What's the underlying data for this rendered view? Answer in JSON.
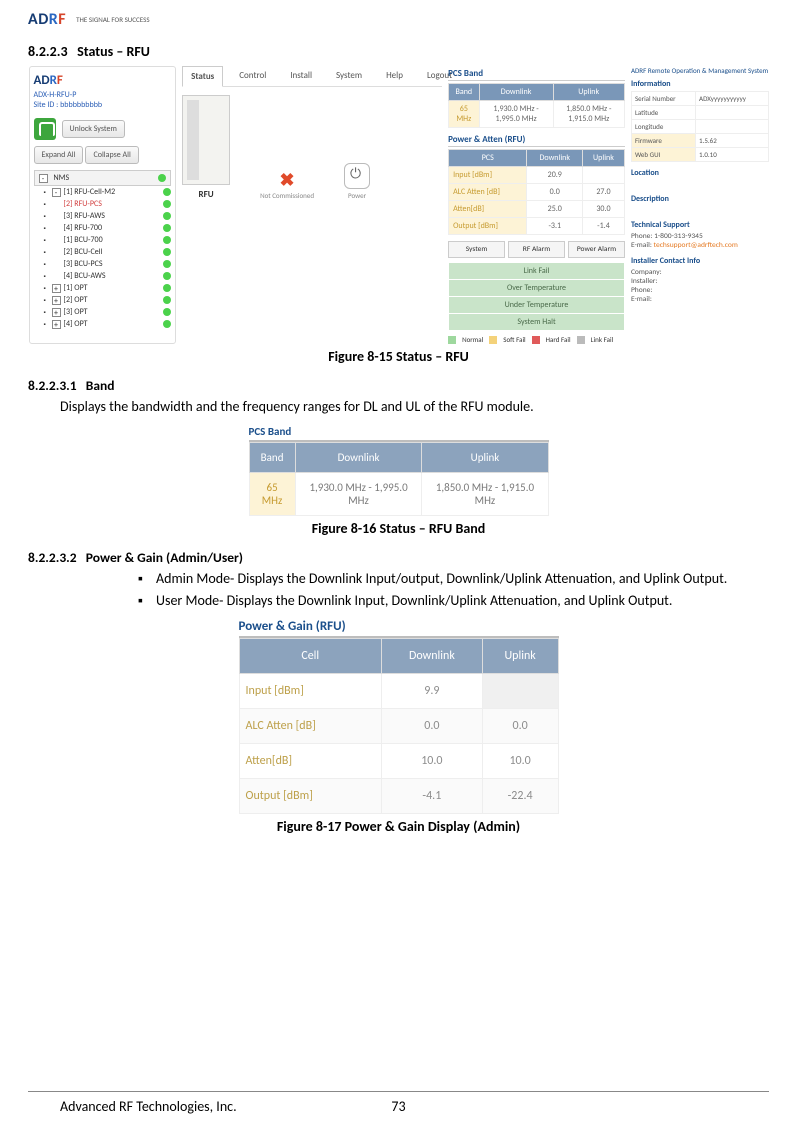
{
  "header_logo": {
    "brand": "ADRF",
    "tagline": "THE SIGNAL FOR SUCCESS"
  },
  "sec_8_2_2_3": {
    "num": "8.2.2.3",
    "title": "Status – RFU"
  },
  "fig15_caption": "Figure 8-15    Status – RFU",
  "sec_8_2_2_3_1": {
    "num": "8.2.2.3.1",
    "title": "Band"
  },
  "band_text": "Displays the bandwidth and the frequency ranges for DL and UL of the RFU module.",
  "fig16_caption": "Figure 8-16    Status – RFU Band",
  "sec_8_2_2_3_2": {
    "num": "8.2.2.3.2",
    "title": "Power & Gain (Admin/User)"
  },
  "bullets": [
    "Admin Mode- Displays the Downlink Input/output, Downlink/Uplink Attenuation, and Uplink Output.",
    "User Mode- Displays the Downlink Input, Downlink/Uplink Attenuation, and Uplink Output."
  ],
  "fig17_caption": "Figure 8-17    Power & Gain Display (Admin)",
  "footer": {
    "company": "Advanced RF Technologies, Inc.",
    "page": "73"
  },
  "shot15": {
    "device_name": "ADX-H-RFU-P",
    "site_id": "Site ID : bbbbbbbbbb",
    "unlock": "Unlock System",
    "expand": "Expand All",
    "collapse": "Collapse All",
    "tree_head": "NMS",
    "tree": [
      {
        "sym": "-",
        "label": "[1] RFU-Cell-M2",
        "red": false
      },
      {
        "sym": "",
        "label": "[2] RFU-PCS",
        "red": true
      },
      {
        "sym": "",
        "label": "[3] RFU-AWS",
        "red": false
      },
      {
        "sym": "",
        "label": "[4] RFU-700",
        "red": false
      },
      {
        "sym": "",
        "label": "[1] BCU-700",
        "red": false
      },
      {
        "sym": "",
        "label": "[2] BCU-Cell",
        "red": false
      },
      {
        "sym": "",
        "label": "[3] BCU-PCS",
        "red": false
      },
      {
        "sym": "",
        "label": "[4] BCU-AWS",
        "red": false
      },
      {
        "sym": "+",
        "label": "[1] OPT",
        "red": false
      },
      {
        "sym": "+",
        "label": "[2] OPT",
        "red": false
      },
      {
        "sym": "+",
        "label": "[3] OPT",
        "red": false
      },
      {
        "sym": "+",
        "label": "[4] OPT",
        "red": false
      }
    ],
    "tabs": [
      "Status",
      "Control",
      "Install",
      "System",
      "Help",
      "Logout"
    ],
    "rfu_label": "RFU",
    "nc_label": "Not Commissioned",
    "power_label": "Power",
    "pcs_band_title": "PCS Band",
    "pcs_band": {
      "headers": [
        "Band",
        "Downlink",
        "Uplink"
      ],
      "row": [
        "65 MHz",
        "1,930.0 MHz - 1,995.0 MHz",
        "1,850.0 MHz - 1,915.0 MHz"
      ]
    },
    "pa_title": "Power & Atten (RFU)",
    "pa": {
      "headers": [
        "PCS",
        "Downlink",
        "Uplink"
      ],
      "rows": [
        [
          "Input [dBm]",
          "20.9",
          ""
        ],
        [
          "ALC Atten [dB]",
          "0.0",
          "27.0"
        ],
        [
          "Atten[dB]",
          "25.0",
          "30.0"
        ],
        [
          "Output [dBm]",
          "-3.1",
          "-1.4"
        ]
      ]
    },
    "status_btns": [
      "System",
      "RF Alarm",
      "Power Alarm"
    ],
    "alarm_rows": [
      "Link Fail",
      "Over Temperature",
      "Under Temperature",
      "System Halt"
    ],
    "legend": [
      "Normal",
      "Soft Fail",
      "Hard Fail",
      "Link Fail"
    ],
    "info": {
      "title1": "ADRF Remote Operation & Management System",
      "title2": "Information",
      "rows": [
        [
          "Serial Number",
          "ADXyyyyyyyyyyy"
        ],
        [
          "Latitude",
          ""
        ],
        [
          "Longitude",
          ""
        ],
        [
          "Firmware",
          "1.5.62"
        ],
        [
          "Web GUI",
          "1.0.10"
        ]
      ],
      "loc": "Location",
      "desc": "Description",
      "tech": "Technical Support",
      "phone": "Phone: 1-800-313-9345",
      "email_lbl": "E-mail: ",
      "email": "techsupport@adrftech.com",
      "inst": "Installer Contact Info",
      "inst_rows": [
        "Company:",
        "Installer:",
        "Phone:",
        "E-mail:"
      ]
    }
  },
  "tbl816": {
    "title": "PCS Band",
    "headers": [
      "Band",
      "Downlink",
      "Uplink"
    ],
    "row": [
      "65 MHz",
      "1,930.0 MHz - 1,995.0 MHz",
      "1,850.0 MHz - 1,915.0 MHz"
    ]
  },
  "tbl817": {
    "title": "Power & Gain (RFU)",
    "headers": [
      "Cell",
      "Downlink",
      "Uplink"
    ],
    "rows": [
      [
        "Input [dBm]",
        "9.9",
        ""
      ],
      [
        "ALC Atten [dB]",
        "0.0",
        "0.0"
      ],
      [
        "Atten[dB]",
        "10.0",
        "10.0"
      ],
      [
        "Output [dBm]",
        "-4.1",
        "-22.4"
      ]
    ]
  }
}
